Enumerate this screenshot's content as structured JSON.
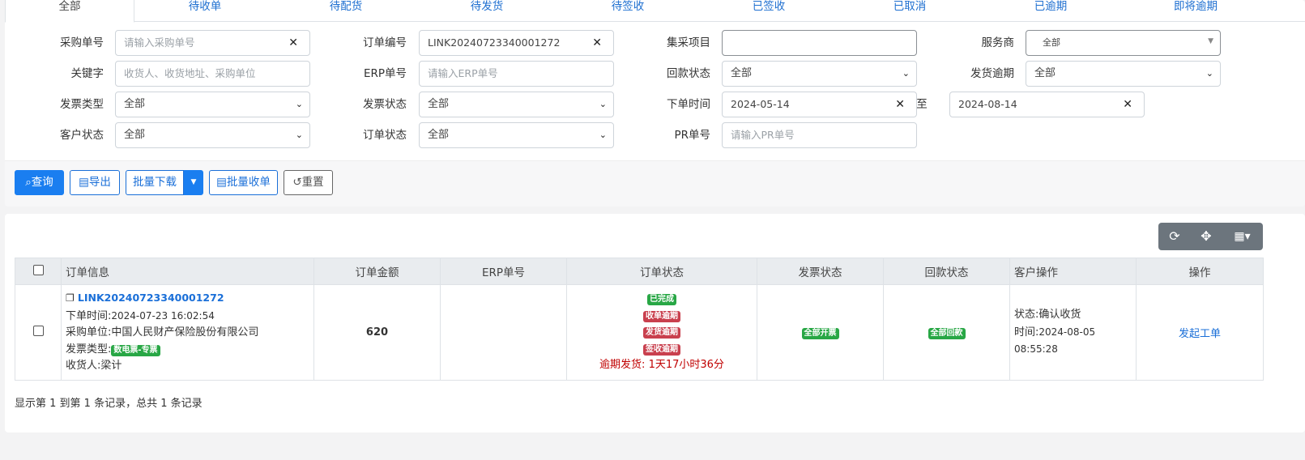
{
  "tabs": [
    "全部",
    "待收单",
    "待配货",
    "待发货",
    "待签收",
    "已签收",
    "已取消",
    "已逾期",
    "即将逾期"
  ],
  "filters": {
    "po_no": {
      "label": "采购单号",
      "placeholder": "请输入采购单号"
    },
    "order_no": {
      "label": "订单编号",
      "value": "LINK20240723340001272"
    },
    "project": {
      "label": "集采项目",
      "value": ""
    },
    "provider": {
      "label": "服务商",
      "value": "全部"
    },
    "keyword": {
      "label": "关键字",
      "placeholder": "收货人、收货地址、采购单位"
    },
    "erp_no": {
      "label": "ERP单号",
      "placeholder": "请输入ERP单号"
    },
    "payback_status": {
      "label": "回款状态",
      "value": "全部"
    },
    "ship_overdue": {
      "label": "发货逾期",
      "value": "全部"
    },
    "invoice_type": {
      "label": "发票类型",
      "value": "全部"
    },
    "invoice_status": {
      "label": "发票状态",
      "value": "全部"
    },
    "order_time": {
      "label": "下单时间",
      "start": "2024-05-14",
      "to": "至",
      "end": "2024-08-14"
    },
    "customer_status": {
      "label": "客户状态",
      "value": "全部"
    },
    "order_status": {
      "label": "订单状态",
      "value": "全部"
    },
    "pr_no": {
      "label": "PR单号",
      "placeholder": "请输入PR单号"
    }
  },
  "buttons": {
    "query": "查询",
    "export": "导出",
    "batch_download": "批量下载",
    "batch_receive": "批量收单",
    "reset": "重置"
  },
  "table": {
    "headers": [
      "订单信息",
      "订单金额",
      "ERP单号",
      "订单状态",
      "发票状态",
      "回款状态",
      "客户操作",
      "操作"
    ],
    "row": {
      "order_no": "LINK20240723340001272",
      "order_time_label": "下单时间:",
      "order_time": "2024-07-23 16:02:54",
      "buyer_label": "采购单位:",
      "buyer": "中国人民财产保险股份有限公司",
      "invoice_type_label": "发票类型:",
      "invoice_type": "数电票-专票",
      "receiver_label": "收货人:",
      "receiver": "梁计",
      "amount": "620",
      "erp_no": "",
      "status_badges": [
        "已完成",
        "收单逾期",
        "发货逾期",
        "签收逾期"
      ],
      "overdue_text": "逾期发货:",
      "overdue_duration": "1天17小时36分",
      "invoice_status": "全部开票",
      "payback_status": "全部回款",
      "customer_state_label": "状态:",
      "customer_state": "确认收货",
      "customer_time_label": "时间:",
      "customer_time": "2024-08-05",
      "customer_time2": "08:55:28",
      "action": "发起工单"
    }
  },
  "summary": "显示第 1 到第 1 条记录，总共 1 条记录",
  "colors": {
    "primary": "#1a7ef0",
    "success": "#28a745",
    "danger": "#c9404e",
    "overdue_text": "#c00000"
  }
}
